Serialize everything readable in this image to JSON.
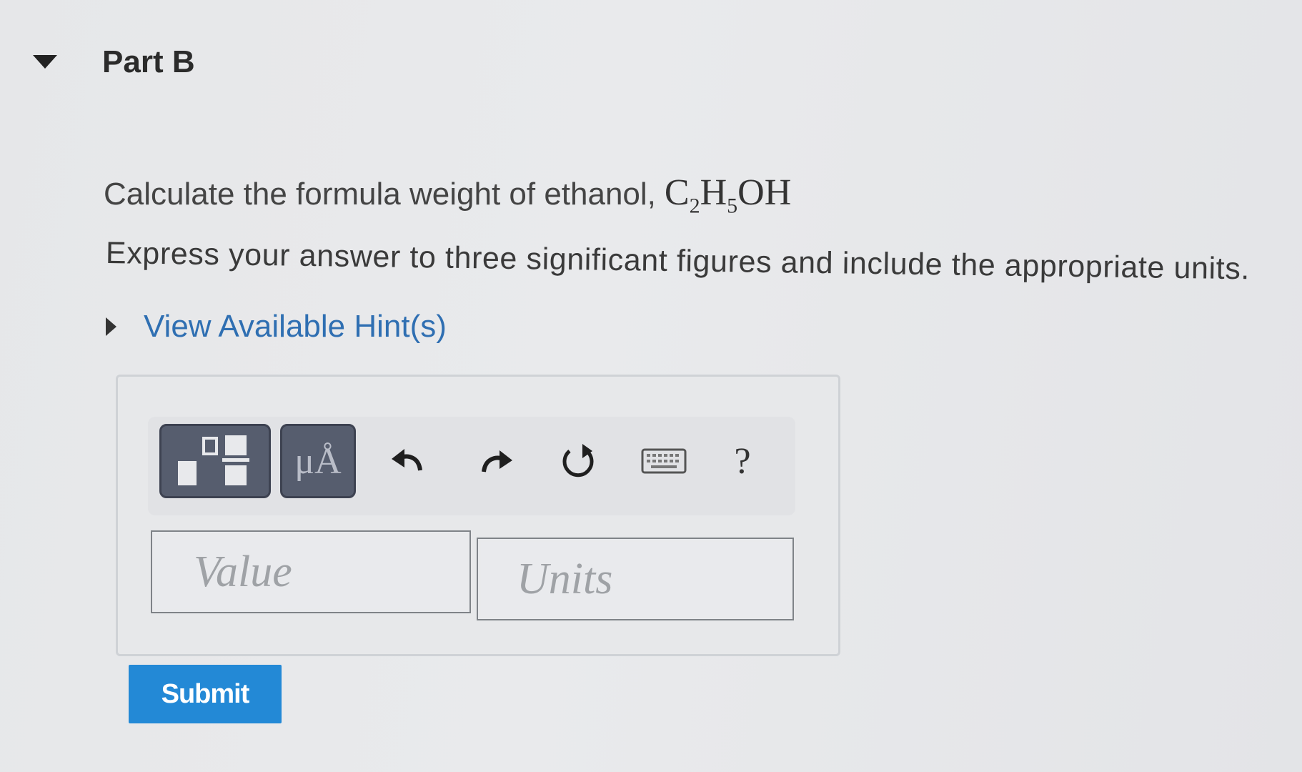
{
  "part": {
    "title": "Part B"
  },
  "question": {
    "text": "Calculate the formula weight of ethanol,",
    "formula": {
      "c": "C",
      "c_sub": "2",
      "h": "H",
      "h_sub": "5",
      "oh": "OH"
    }
  },
  "instruction": "Express your answer to three significant figures and include the appropriate units.",
  "hints": {
    "label": "View Available Hint(s)"
  },
  "toolbar": {
    "symbols_label": "μÅ",
    "help_label": "?"
  },
  "inputs": {
    "value_placeholder": "Value",
    "units_placeholder": "Units"
  },
  "submit": {
    "label": "Submit"
  },
  "colors": {
    "link": "#2f6fb2",
    "submit_bg": "#2389d6",
    "toolbar_button": "#565d6e"
  }
}
